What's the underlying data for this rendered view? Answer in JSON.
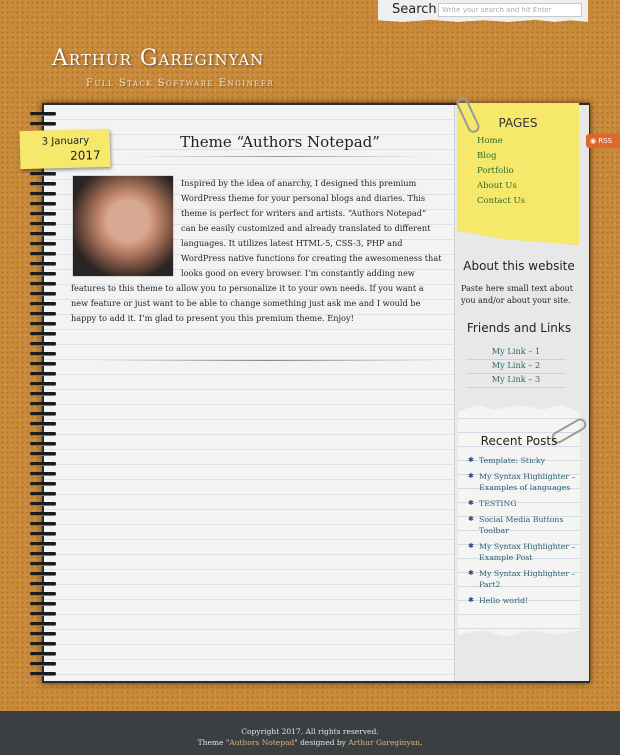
{
  "search": {
    "label": "Search",
    "placeholder": "Write your search and hit Enter"
  },
  "header": {
    "title": "Arthur Gareginyan",
    "tagline": "Full Stack Software Engineer"
  },
  "post": {
    "date_day": "3 January",
    "date_year": "2017",
    "title": "Theme “Authors Notepad”",
    "body": "Inspired by the idea of anarchy, I designed this premium WordPress theme for your personal blogs and diaries. This theme is perfect for writers and artists. “Authors Notepad” can be easily customized and already translated to different languages. It utilizes latest HTML-5, CSS-3, PHP and WordPress native functions for creating the awesomeness that looks good on every browser. I’m constantly adding new features to this theme to allow you to personalize it to your own needs. If you want a new feature or just want to be able to change something just ask me and I would be happy to add it. I’m glad to present you this premium theme. Enjoy!"
  },
  "rss": {
    "label": "RSS"
  },
  "sidebar": {
    "pages_title": "PAGES",
    "pages": [
      {
        "label": "Home"
      },
      {
        "label": "Blog"
      },
      {
        "label": "Portfolio"
      },
      {
        "label": "About Us"
      },
      {
        "label": "Contact Us"
      }
    ],
    "about_title": "About this website",
    "about_text": "Paste here small text about you and/or about your site.",
    "links_title": "Friends and Links",
    "links": [
      {
        "label": "My Link – 1"
      },
      {
        "label": "My Link – 2"
      },
      {
        "label": "My Link – 3"
      }
    ],
    "recent_title": "Recent Posts",
    "recent": [
      {
        "label": "Template: Sticky"
      },
      {
        "label": "My Syntax Highlighter – Examples of languages"
      },
      {
        "label": "TESTING"
      },
      {
        "label": "Social Media Buttons Toolbar"
      },
      {
        "label": "My Syntax Highlighter – Example Post"
      },
      {
        "label": "My Syntax Highlighter – Part2"
      },
      {
        "label": "Hello world!"
      }
    ]
  },
  "footer": {
    "copyright": "Copyright 2017. All rights reserved.",
    "theme_prefix": "Theme \"",
    "theme_name": "Authors Notepad",
    "designed_by": "\" designed by ",
    "author": "Arthur Gareginyan",
    "period": "."
  }
}
